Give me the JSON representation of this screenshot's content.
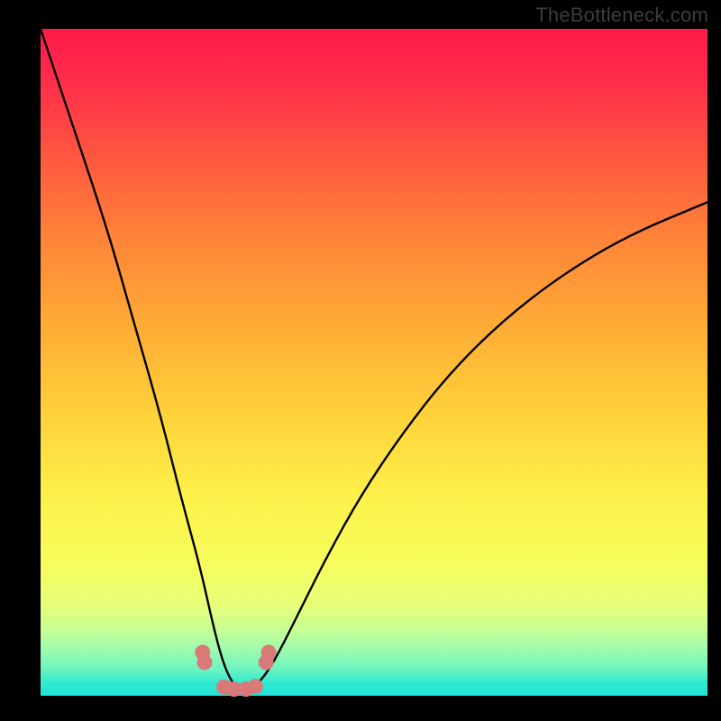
{
  "watermark": "TheBottleneck.com",
  "chart_data": {
    "type": "line",
    "title": "",
    "xlabel": "",
    "ylabel": "",
    "xlim": [
      0,
      100
    ],
    "ylim": [
      0,
      100
    ],
    "grid": false,
    "background_gradient": {
      "top": "#ff1a4b",
      "middle": "#ffd23a",
      "bottom": "#1ee3d8"
    },
    "series": [
      {
        "name": "bottleneck-curve",
        "color": "#000000",
        "x": [
          0,
          5,
          10,
          14,
          18,
          21,
          24,
          26,
          27.5,
          29,
          30.5,
          32,
          34,
          36,
          39,
          43,
          48,
          54,
          61,
          69,
          78,
          88,
          100
        ],
        "values": [
          100,
          85,
          70,
          56,
          42,
          30,
          19,
          10,
          4.5,
          1.5,
          0.5,
          1.2,
          3.5,
          7,
          13,
          21,
          30,
          39,
          48,
          56,
          63,
          69,
          74
        ]
      },
      {
        "name": "marker-points",
        "color": "#d97a78",
        "type": "scatter",
        "x": [
          24.3,
          24.6,
          27.5,
          29.0,
          30.8,
          32.2,
          33.8,
          34.2
        ],
        "values": [
          6.5,
          5.0,
          1.3,
          1.0,
          1.0,
          1.4,
          5.0,
          6.5
        ]
      }
    ]
  }
}
